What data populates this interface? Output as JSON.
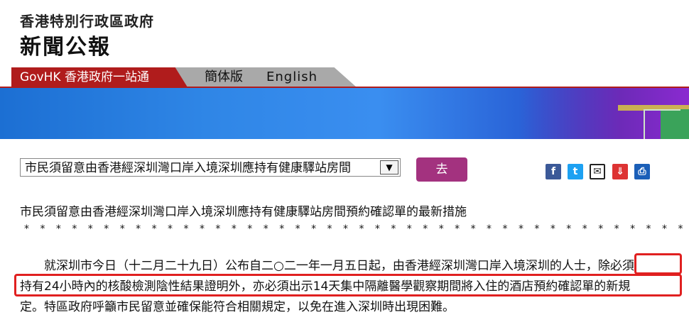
{
  "header": {
    "govt_name": "香港特別行政區政府",
    "press_title": "新聞公報"
  },
  "nav": {
    "govhk_label": "GovHK 香港政府一站通",
    "simplified_label": "簡体版",
    "english_label": "English"
  },
  "selector": {
    "selected_value": "市民須留意由香港經深圳灣口岸入境深圳應持有健康驛站房間"
  },
  "go_button": "去",
  "share_icons": [
    "facebook-icon",
    "twitter-icon",
    "email-icon",
    "bookmark-icon",
    "print-icon"
  ],
  "article": {
    "title": "市民須留意由香港經深圳灣口岸入境深圳應持有健康驛站房間預約確認單的最新措施",
    "separator": "*******************************************",
    "line1": "就深圳市今日（十二月二十九日）公布自二○二一年一月五日起，由香港經深圳灣口岸入境深圳的人士，除必須",
    "line2": "持有24小時內的核酸檢測陰性結果證明外，亦必須出示14天集中隔離醫學觀察期間將入住的酒店預約確認單的新規",
    "line3": "定。特區政府呼籲市民留意並確保能符合相關規定，以免在進入深圳時出現困難。"
  },
  "colors": {
    "govhk_red": "#b01c1c",
    "go_button": "#a3327f",
    "highlight": "#e02020",
    "banner_blue": "#2f86e6"
  }
}
